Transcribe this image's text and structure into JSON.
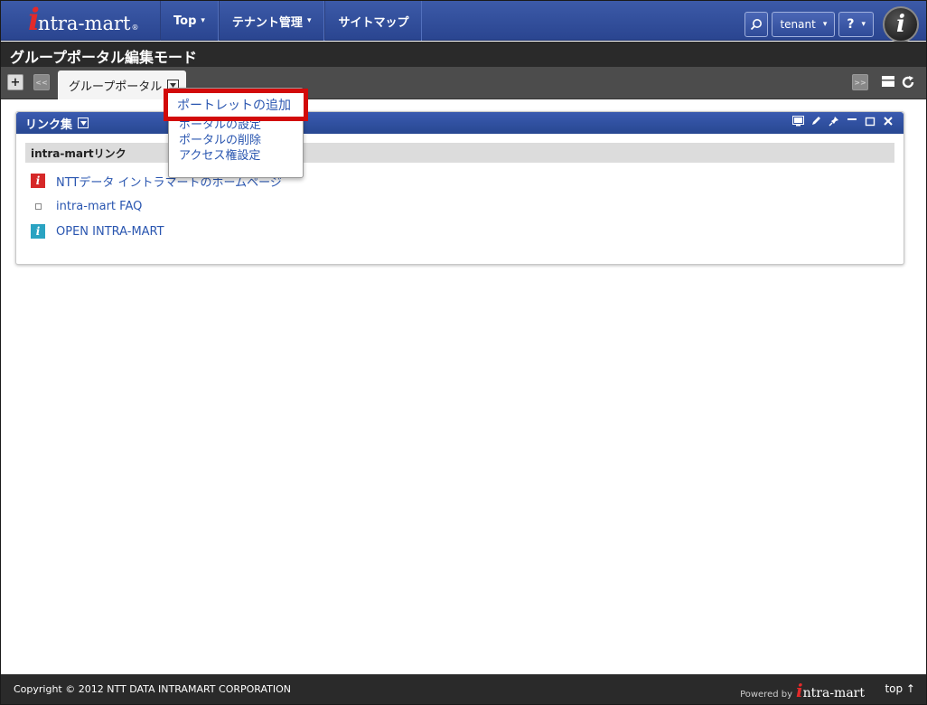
{
  "app": {
    "logo_mark": "i",
    "logo_text": "ntra-mart",
    "logo_reg": "®"
  },
  "nav": {
    "items": [
      {
        "label": "Top"
      },
      {
        "label": "テナント管理"
      },
      {
        "label": "サイトマップ"
      }
    ],
    "user_label": "tenant",
    "help_label": "?",
    "caret": "▾"
  },
  "page": {
    "title": "グループポータル編集モード"
  },
  "tabbar": {
    "add_label": "+",
    "prev_label": "<<",
    "next_label": ">>",
    "active_tab": "グループポータル"
  },
  "dropdown_menu": {
    "items": [
      "ポートレットの追加",
      "ポータルの設定",
      "ポータルの削除",
      "アクセス権設定"
    ],
    "highlighted_index": 0
  },
  "portlet": {
    "title": "リンク集",
    "section_title": "intra-martリンク",
    "links": [
      {
        "label": "NTTデータ イントラマートのホームページ",
        "icon": "intra-mart-red-icon"
      },
      {
        "label": "intra-mart FAQ",
        "icon": "square-bullet-icon"
      },
      {
        "label": "OPEN INTRA-MART",
        "icon": "intra-mart-teal-icon"
      }
    ]
  },
  "footer": {
    "copyright": "Copyright © 2012 NTT DATA INTRAMART CORPORATION",
    "powered_by": "Powered by",
    "logo_mark": "i",
    "logo_text": "ntra-mart",
    "top_label": "top ↑"
  },
  "colors": {
    "nav_blue": "#2f4b98",
    "highlight_red": "#d20a0a",
    "link_blue": "#2a56b0"
  }
}
